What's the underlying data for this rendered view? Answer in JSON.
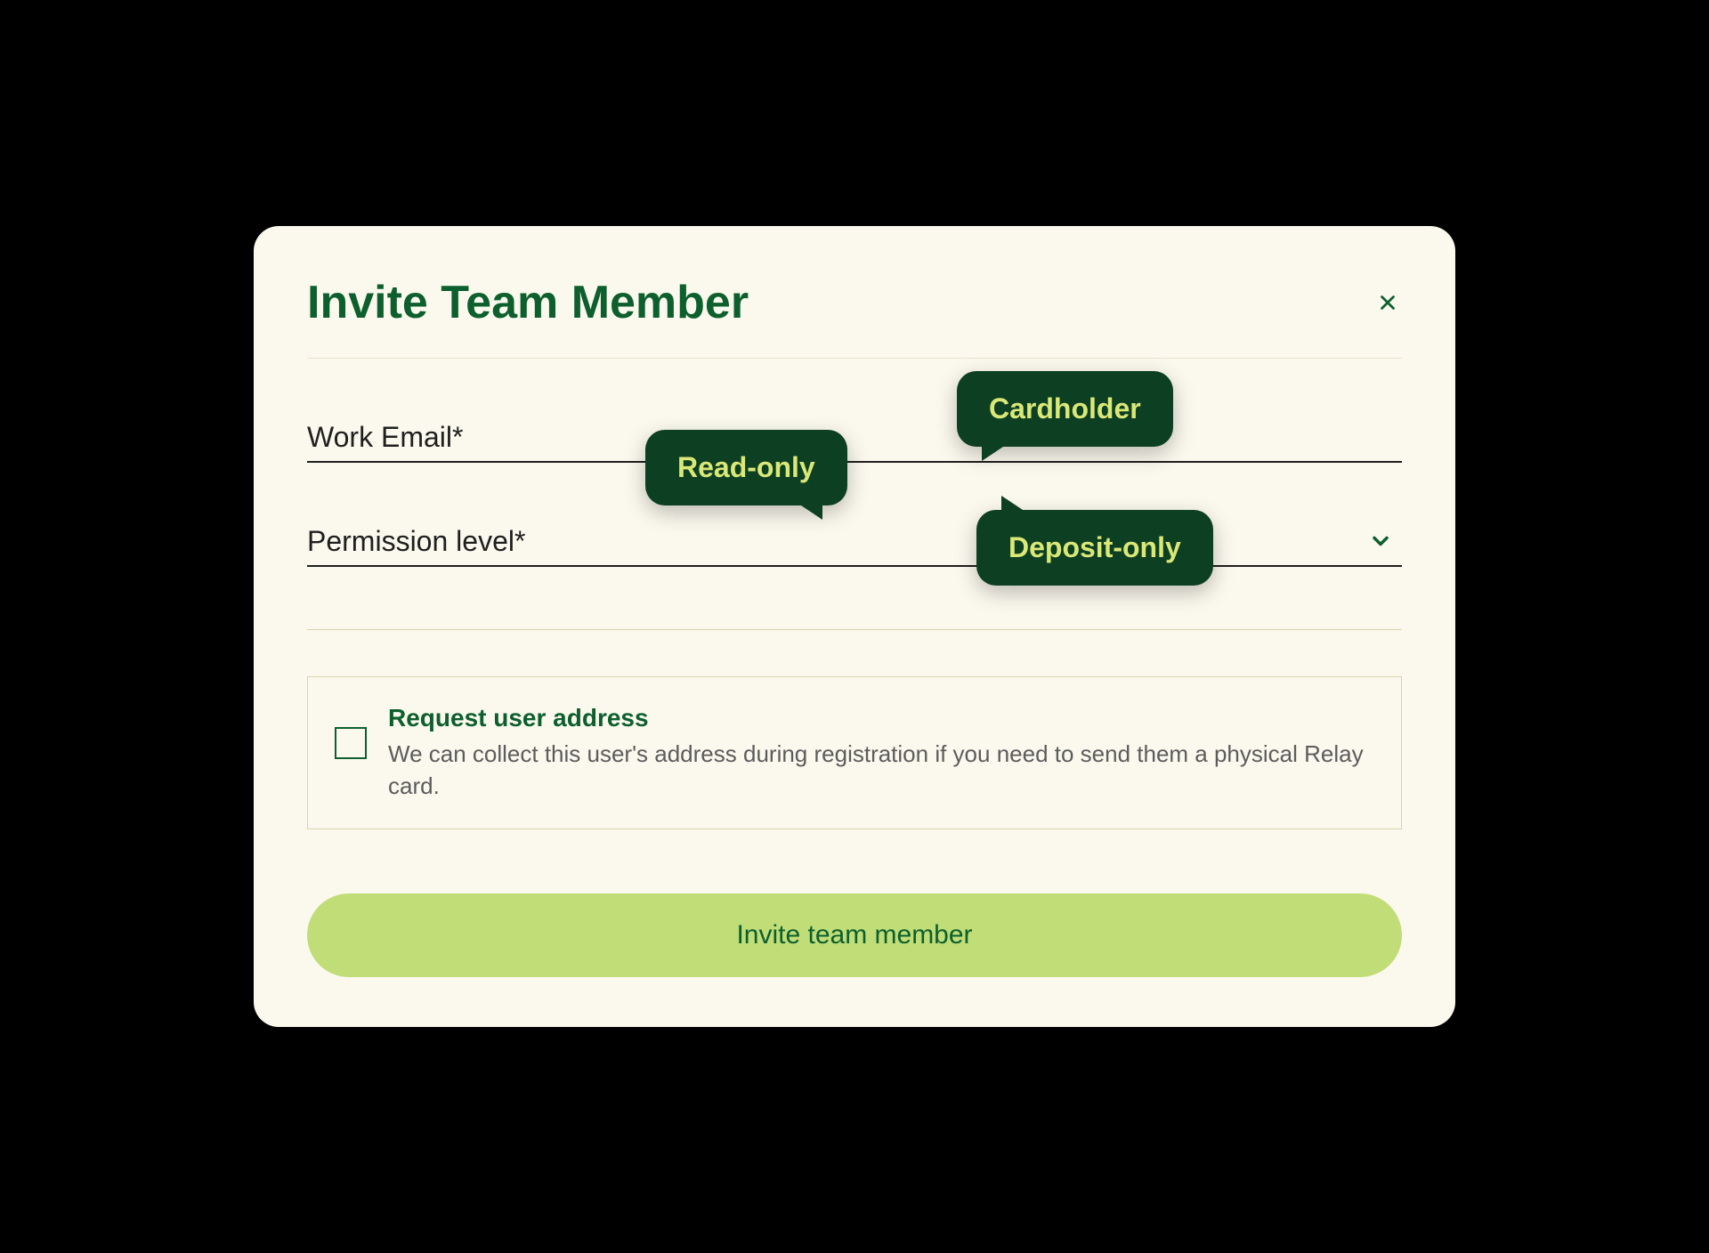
{
  "modal": {
    "title": "Invite Team Member",
    "fields": {
      "email_label": "Work Email*",
      "permission_label": "Permission level*"
    },
    "permission_options": {
      "cardholder": "Cardholder",
      "readonly": "Read-only",
      "deposit": "Deposit-only"
    },
    "callout": {
      "title": "Request user address",
      "description": "We can collect this user's address during registration if you need to send them a physical Relay card."
    },
    "submit_label": "Invite team member"
  },
  "colors": {
    "primary_green": "#0d5f2e",
    "dark_green": "#0d3f22",
    "light_green": "#c0dd77",
    "accent_yellow": "#d9e876",
    "cream": "#fbf9ed"
  }
}
